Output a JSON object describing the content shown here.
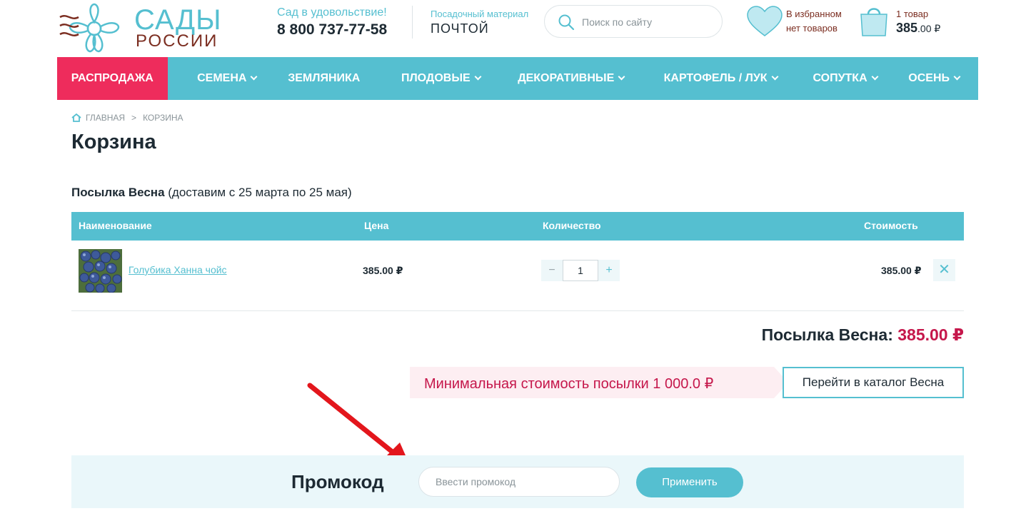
{
  "header": {
    "logo": {
      "line1": "САДЫ",
      "line2": "РОССИИ",
      "icon": "flower-logo-icon"
    },
    "tagline": "Сад в удовольствие!",
    "phone": "8 800 737-77-58",
    "material_label": "Посадочный материал",
    "material_value": "ПОЧТОЙ",
    "search": {
      "placeholder": "Поиск по сайту",
      "value": "",
      "icon": "search-icon"
    },
    "favorites": {
      "line1": "В избранном",
      "line2": "нет товаров",
      "icon": "heart-icon"
    },
    "cart": {
      "count": "1 товар",
      "total_main": "385",
      "total_cents": ".00 ₽",
      "icon": "shopping-bag-icon"
    }
  },
  "nav": [
    {
      "label": "РАСПРОДАЖА",
      "dropdown": false
    },
    {
      "label": "СЕМЕНА",
      "dropdown": true
    },
    {
      "label": "ЗЕМЛЯНИКА",
      "dropdown": false
    },
    {
      "label": "ПЛОДОВЫЕ",
      "dropdown": true
    },
    {
      "label": "ДЕКОРАТИВНЫЕ",
      "dropdown": true
    },
    {
      "label": "КАРТОФЕЛЬ / ЛУК",
      "dropdown": true
    },
    {
      "label": "СОПУТКА",
      "dropdown": true
    },
    {
      "label": "ОСЕНЬ",
      "dropdown": true
    }
  ],
  "breadcrumb": {
    "home": "ГЛАВНАЯ",
    "separator": ">",
    "current": "КОРЗИНА"
  },
  "page_title": "Корзина",
  "parcel": {
    "name": "Посылка Весна",
    "delivery": "(доставим с 25 марта по 25 мая)",
    "columns": [
      "Наименование",
      "Цена",
      "Количество",
      "Стоимость"
    ],
    "items": [
      {
        "name": "Голубика Ханна чойс",
        "price": "385.00 ₽",
        "quantity": "1",
        "cost": "385.00 ₽"
      }
    ],
    "qty_minus": "−",
    "qty_plus": "+",
    "remove": "✕",
    "subtotal_label": "Посылка Весна:",
    "subtotal_value": "385.00 ₽",
    "min_notice": "Минимальная стоимость посылки 1 000.0 ₽",
    "catalog_button": "Перейти в каталог Весна"
  },
  "promo": {
    "label": "Промокод",
    "placeholder": "Ввести промокод",
    "value": "",
    "apply_button": "Применить"
  },
  "colors": {
    "accent": "#55bfd0",
    "sale": "#ee2c5c",
    "price": "#c5174b",
    "brown": "#7b2d20",
    "annotation": "#e3161c"
  }
}
